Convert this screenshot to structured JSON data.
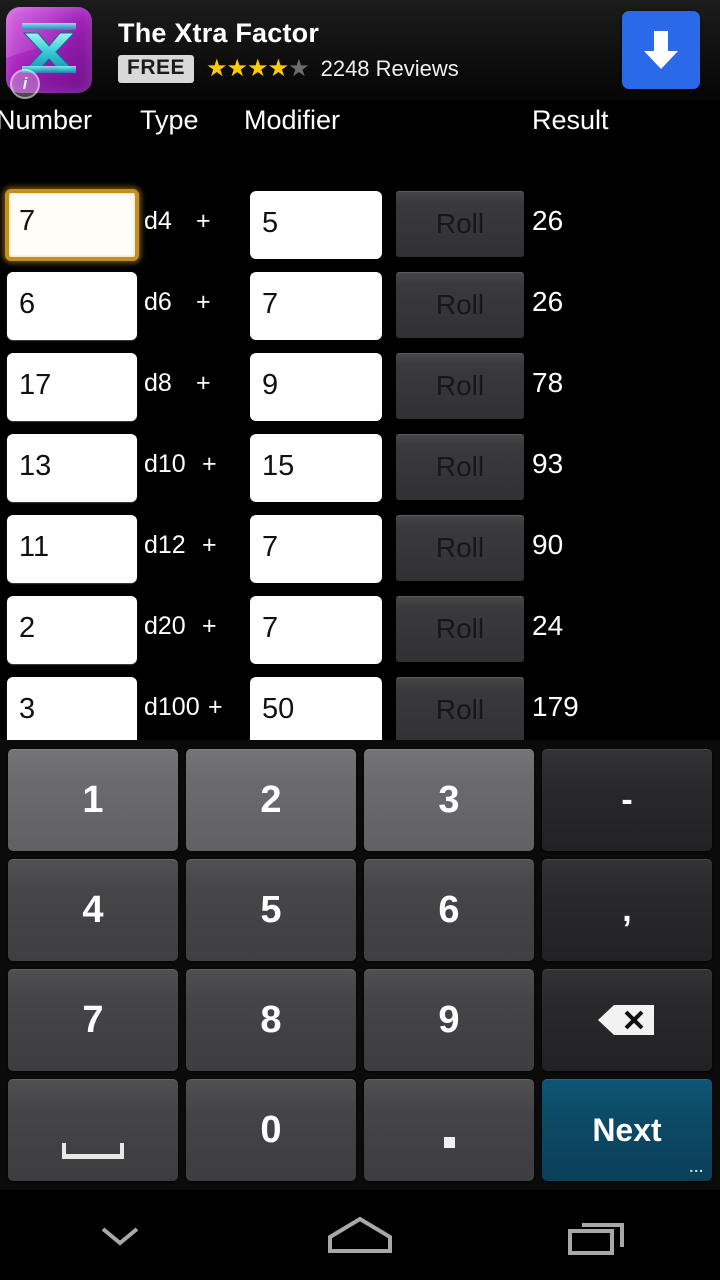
{
  "ad": {
    "title": "The Xtra Factor",
    "price_badge": "FREE",
    "stars_filled": 4,
    "stars_total": 5,
    "reviews": "2248 Reviews",
    "icon_name": "x-factor-app-icon",
    "download_icon": "download-arrow-icon",
    "info_badge": "i",
    "colors": {
      "icon_gradient_start": "#d24ce0",
      "icon_gradient_end": "#6d0f86",
      "download_button": "#2a6ae8",
      "star_on": "#ffcc00",
      "star_off": "#6d6d6d"
    }
  },
  "columns": {
    "number": "Number",
    "type": "Type",
    "modifier": "Modifier",
    "result": "Result"
  },
  "roll_label": "Roll",
  "plus_label": "+",
  "rows": [
    {
      "number": "7",
      "dice": "d4",
      "modifier": "5",
      "result": "26",
      "focused": true
    },
    {
      "number": "6",
      "dice": "d6",
      "modifier": "7",
      "result": "26",
      "focused": false
    },
    {
      "number": "17",
      "dice": "d8",
      "modifier": "9",
      "result": "78",
      "focused": false
    },
    {
      "number": "13",
      "dice": "d10",
      "modifier": "15",
      "result": "93",
      "focused": false
    },
    {
      "number": "11",
      "dice": "d12",
      "modifier": "7",
      "result": "90",
      "focused": false
    },
    {
      "number": "2",
      "dice": "d20",
      "modifier": "7",
      "result": "24",
      "focused": false
    },
    {
      "number": "3",
      "dice": "d100",
      "modifier": "50",
      "result": "179",
      "focused": false
    }
  ],
  "keyboard": {
    "rows": [
      [
        {
          "label": "1",
          "name": "key-1",
          "type": "num"
        },
        {
          "label": "2",
          "name": "key-2",
          "type": "num"
        },
        {
          "label": "3",
          "name": "key-3",
          "type": "num"
        },
        {
          "label": "-",
          "name": "key-minus",
          "type": "fn"
        }
      ],
      [
        {
          "label": "4",
          "name": "key-4",
          "type": "num"
        },
        {
          "label": "5",
          "name": "key-5",
          "type": "num"
        },
        {
          "label": "6",
          "name": "key-6",
          "type": "num"
        },
        {
          "label": ",",
          "name": "key-comma",
          "type": "fn"
        }
      ],
      [
        {
          "label": "7",
          "name": "key-7",
          "type": "num"
        },
        {
          "label": "8",
          "name": "key-8",
          "type": "num"
        },
        {
          "label": "9",
          "name": "key-9",
          "type": "num"
        },
        {
          "label": "",
          "name": "key-backspace",
          "type": "fn",
          "icon": "backspace-icon"
        }
      ],
      [
        {
          "label": "",
          "name": "key-space",
          "type": "num",
          "icon": "spacebar-icon"
        },
        {
          "label": "0",
          "name": "key-0",
          "type": "num"
        },
        {
          "label": "",
          "name": "key-period",
          "type": "num",
          "icon": "period-icon"
        },
        {
          "label": "Next",
          "name": "key-next",
          "type": "next",
          "dots": "..."
        }
      ]
    ],
    "next_accent": "#0c4a66"
  },
  "navbar": {
    "back": "hide-keyboard-chevron-icon",
    "home": "home-icon",
    "recents": "recent-apps-icon"
  }
}
